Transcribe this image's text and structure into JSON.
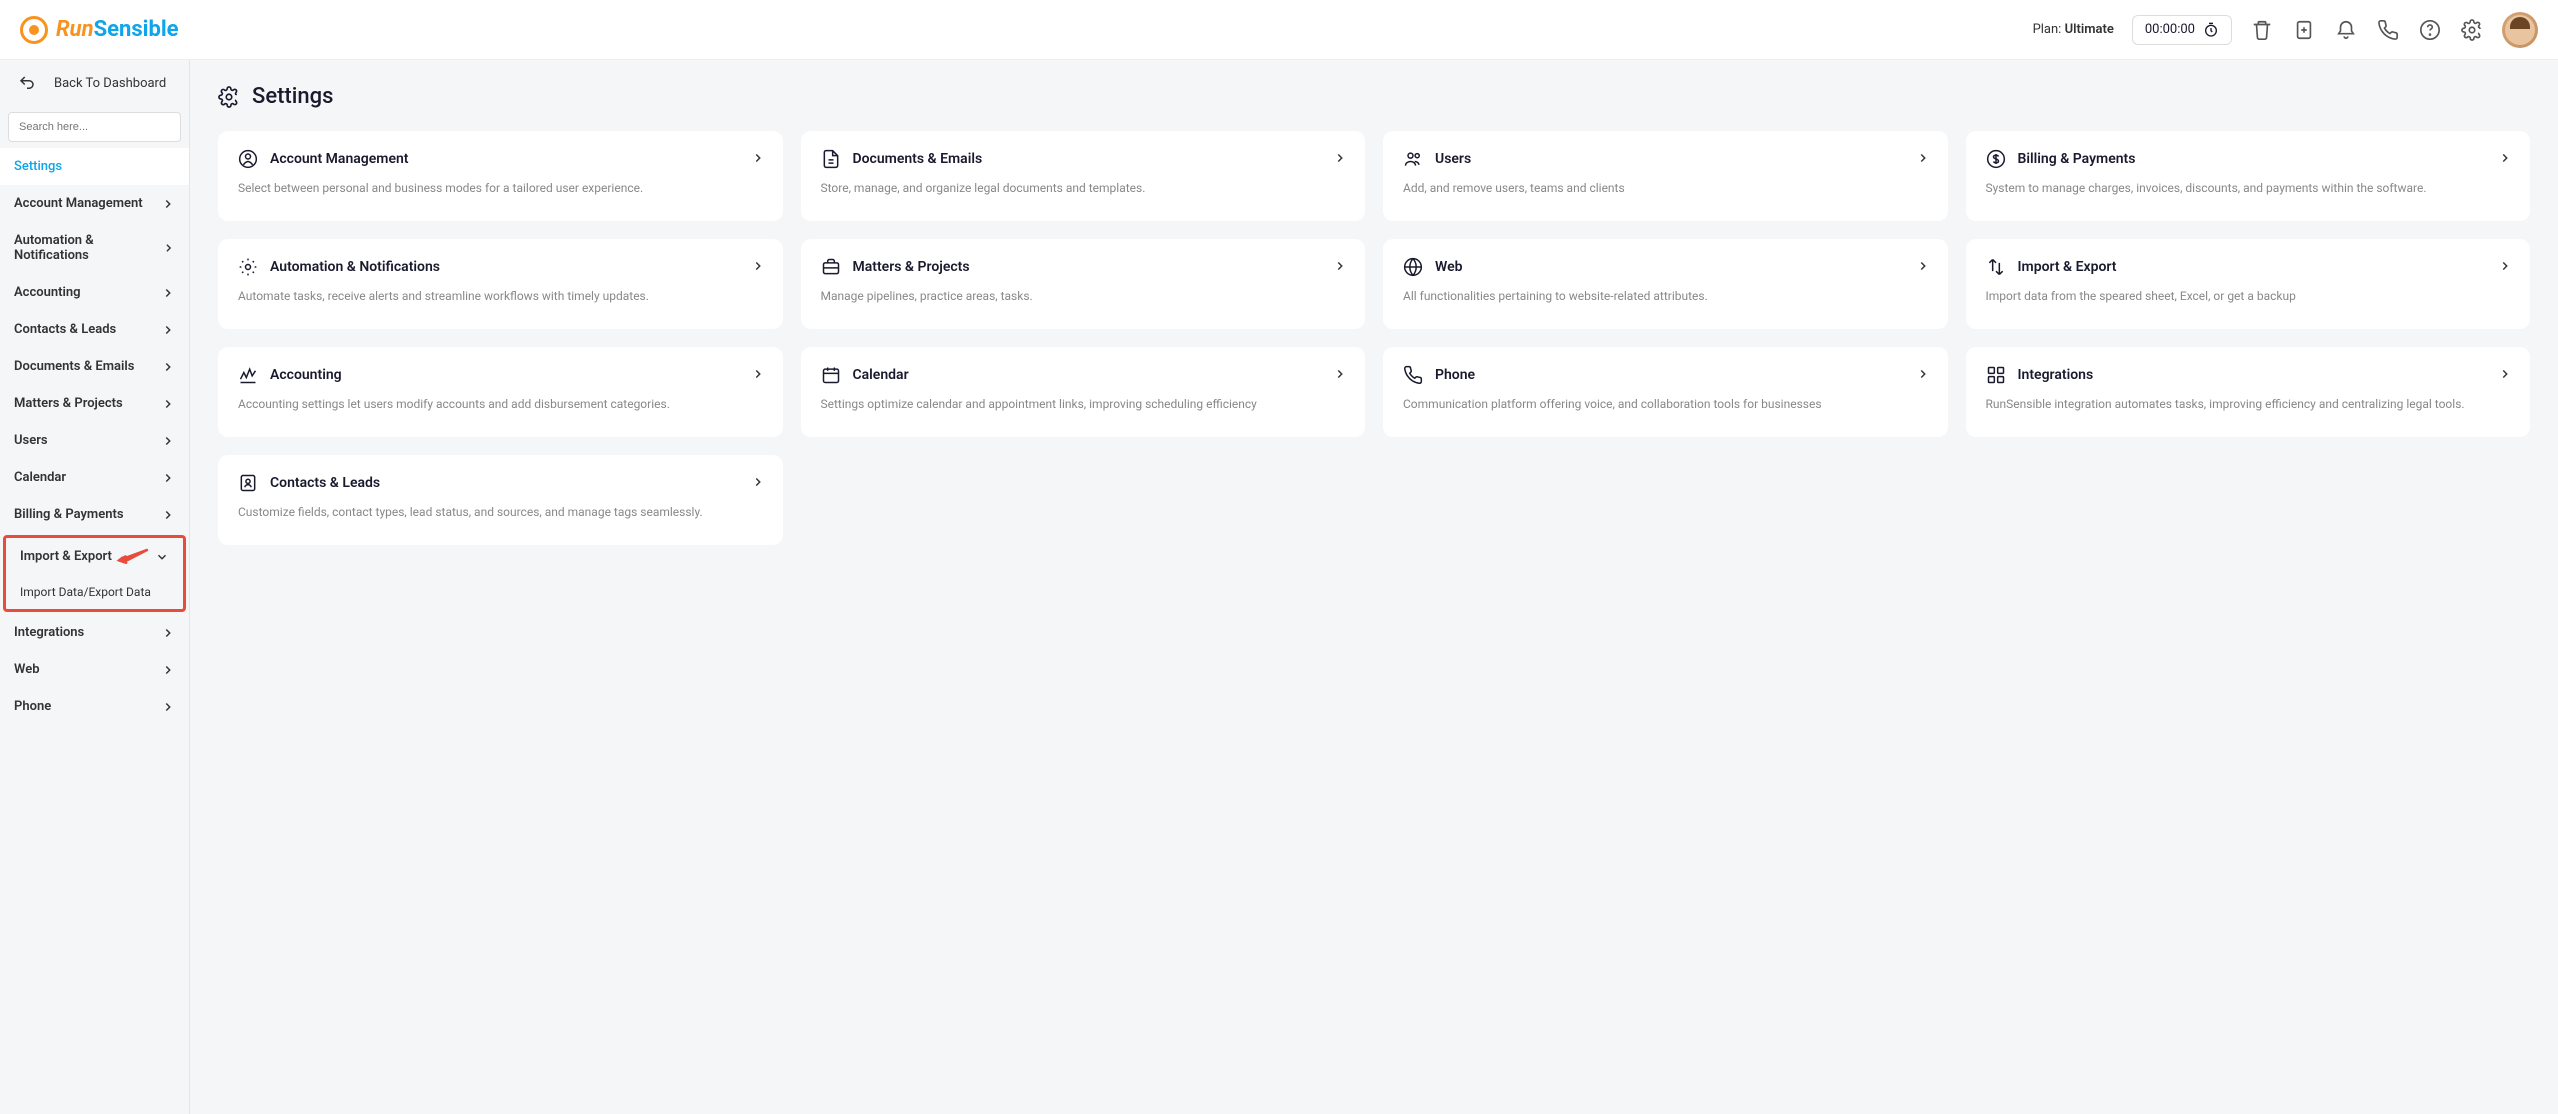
{
  "header": {
    "logo_run": "Run",
    "logo_sensible": "Sensible",
    "plan_label": "Plan:",
    "plan_value": "Ultimate",
    "timer": "00:00:00"
  },
  "sidebar": {
    "back_label": "Back To Dashboard",
    "search_placeholder": "Search here...",
    "settings_label": "Settings",
    "items": [
      {
        "label": "Account Management"
      },
      {
        "label": "Automation & Notifications"
      },
      {
        "label": "Accounting"
      },
      {
        "label": "Contacts & Leads"
      },
      {
        "label": "Documents & Emails"
      },
      {
        "label": "Matters & Projects"
      },
      {
        "label": "Users"
      },
      {
        "label": "Calendar"
      },
      {
        "label": "Billing & Payments"
      }
    ],
    "import_export": {
      "label": "Import & Export",
      "sub": "Import Data/Export Data"
    },
    "items2": [
      {
        "label": "Integrations"
      },
      {
        "label": "Web"
      },
      {
        "label": "Phone"
      }
    ]
  },
  "main": {
    "title": "Settings",
    "cards": [
      {
        "title": "Account Management",
        "desc": "Select between personal and business modes for a tailored user experience.",
        "icon": "user-circle"
      },
      {
        "title": "Documents & Emails",
        "desc": "Store, manage, and organize legal documents and templates.",
        "icon": "document"
      },
      {
        "title": "Users",
        "desc": "Add, and remove users, teams and clients",
        "icon": "users"
      },
      {
        "title": "Billing & Payments",
        "desc": "System to manage charges, invoices, discounts, and payments within the software.",
        "icon": "dollar"
      },
      {
        "title": "Automation & Notifications",
        "desc": "Automate tasks, receive alerts and streamline workflows with timely updates.",
        "icon": "gear-sparkle"
      },
      {
        "title": "Matters & Projects",
        "desc": "Manage pipelines, practice areas, tasks.",
        "icon": "briefcase"
      },
      {
        "title": "Web",
        "desc": "All functionalities pertaining to website-related attributes.",
        "icon": "globe"
      },
      {
        "title": "Import & Export",
        "desc": "Import data from the speared sheet, Excel, or get a backup",
        "icon": "transfer"
      },
      {
        "title": "Accounting",
        "desc": "Accounting settings let users modify accounts and add disbursement categories.",
        "icon": "signature"
      },
      {
        "title": "Calendar",
        "desc": "Settings optimize calendar and appointment links, improving scheduling efficiency",
        "icon": "calendar"
      },
      {
        "title": "Phone",
        "desc": "Communication platform offering voice, and collaboration tools for businesses",
        "icon": "phone"
      },
      {
        "title": "Integrations",
        "desc": "RunSensible integration automates tasks, improving efficiency and centralizing legal tools.",
        "icon": "integrations"
      },
      {
        "title": "Contacts & Leads",
        "desc": "Customize fields, contact types, lead status, and sources, and manage tags seamlessly.",
        "icon": "contacts"
      }
    ]
  }
}
